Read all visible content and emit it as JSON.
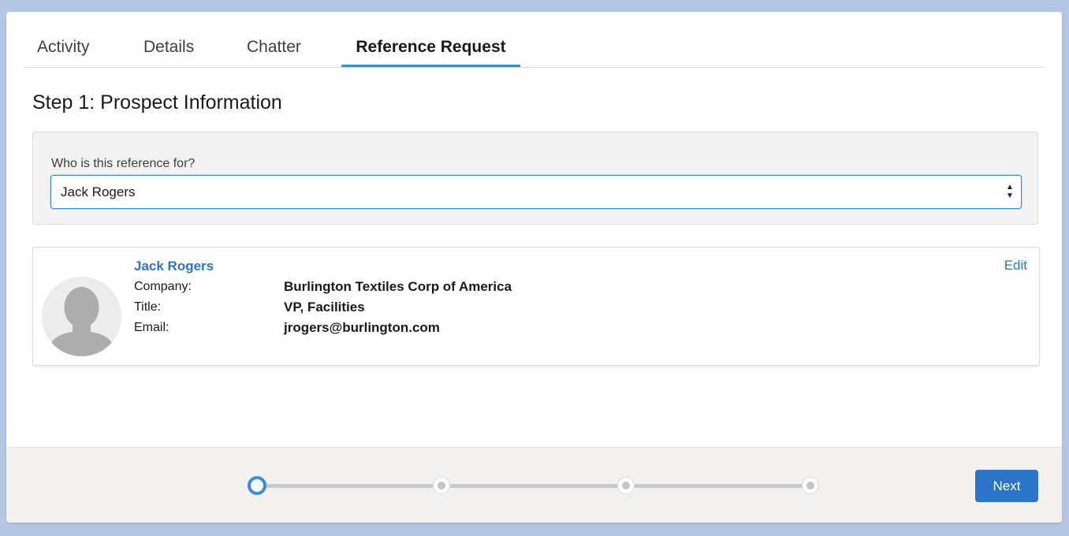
{
  "tabs": [
    {
      "label": "Activity"
    },
    {
      "label": "Details"
    },
    {
      "label": "Chatter"
    },
    {
      "label": "Reference Request",
      "active": true
    }
  ],
  "step": {
    "title": "Step 1: Prospect Information"
  },
  "reference_for": {
    "label": "Who is this reference for?",
    "selected": "Jack Rogers"
  },
  "contact": {
    "name": "Jack Rogers",
    "edit_label": "Edit",
    "company_label": "Company:",
    "company": "Burlington Textiles Corp of America",
    "title_label": "Title:",
    "title": "VP, Facilities",
    "email_label": "Email:",
    "email": "jrogers@burlington.com"
  },
  "progress": {
    "current_step": 1,
    "total_steps": 4
  },
  "footer": {
    "next_label": "Next"
  },
  "colors": {
    "accent": "#3c8be0",
    "button": "#2b74c8",
    "link": "#2b74c8",
    "background": "#b3c6e4"
  }
}
